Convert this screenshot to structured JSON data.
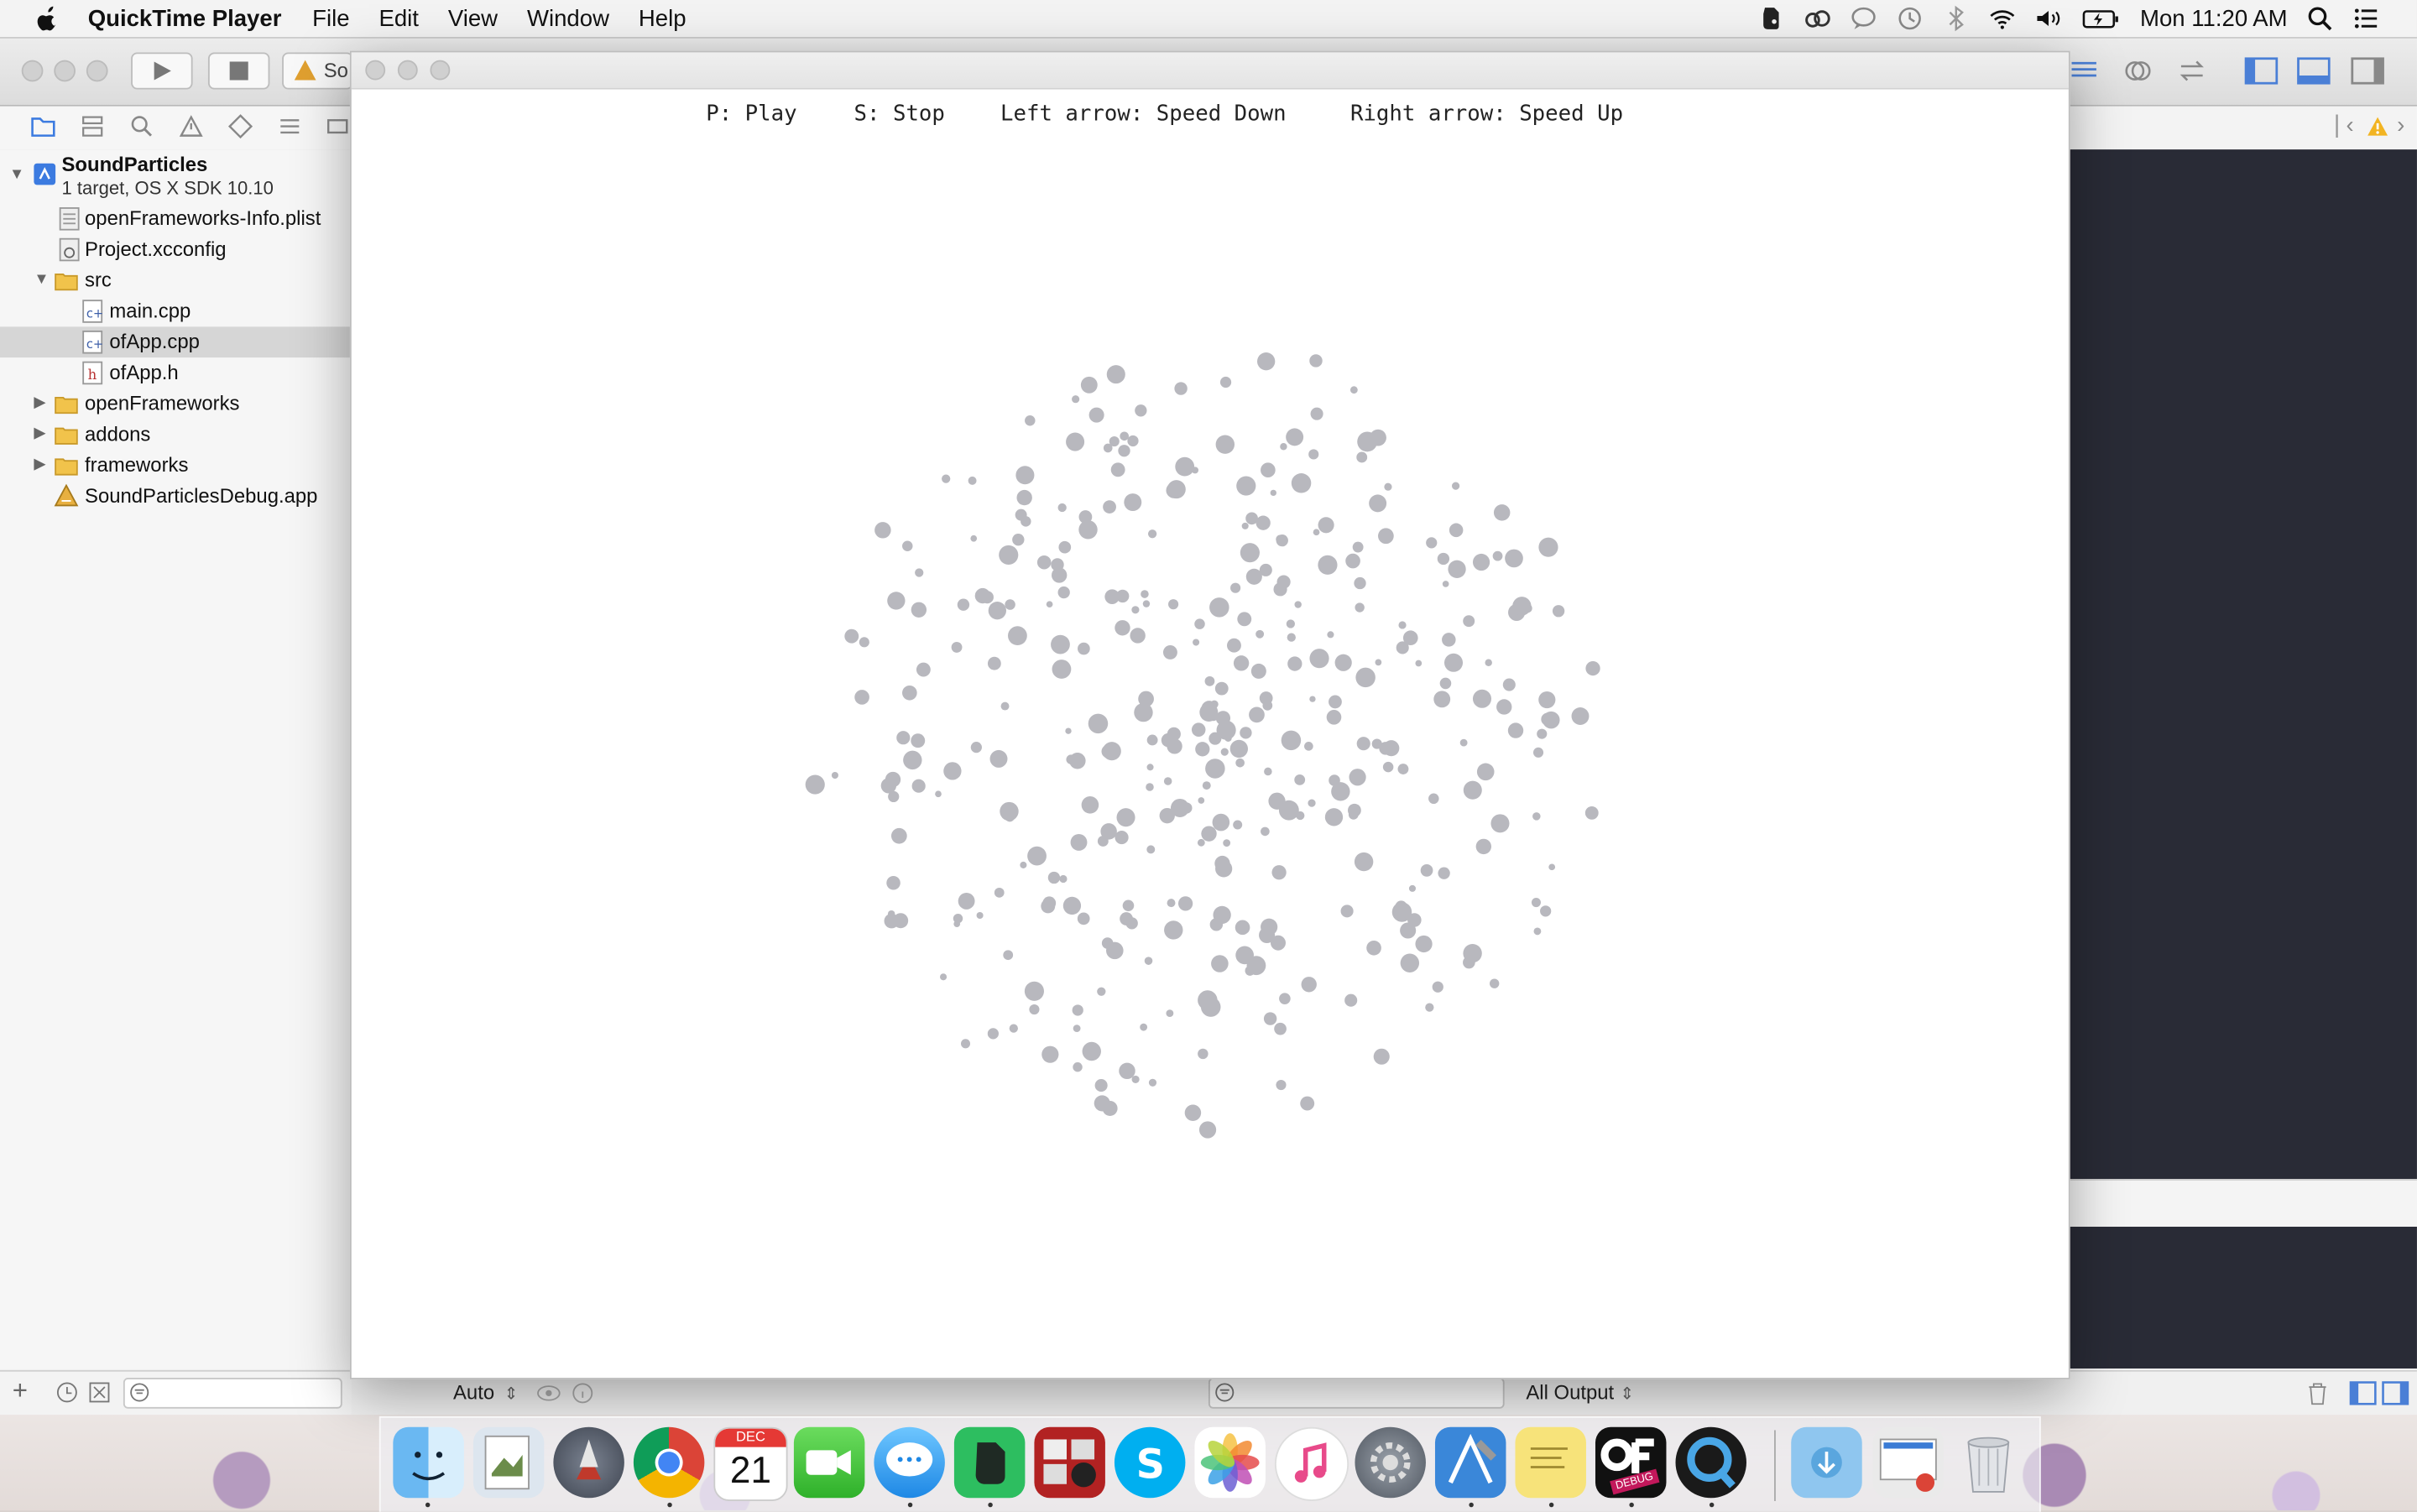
{
  "menubar": {
    "app_name": "QuickTime Player",
    "items": [
      "File",
      "Edit",
      "View",
      "Window",
      "Help"
    ],
    "clock": "Mon 11:20 AM",
    "status_icons": [
      "evernote-icon",
      "creative-cloud-icon",
      "messages-icon",
      "time-machine-icon",
      "bluetooth-icon",
      "wifi-icon",
      "volume-icon",
      "battery-icon",
      "spotlight-icon",
      "notification-center-icon"
    ]
  },
  "xcode": {
    "scheme_partial": "So",
    "project": {
      "name": "SoundParticles",
      "subtitle": "1 target, OS X SDK 10.10"
    },
    "files": [
      {
        "label": "openFrameworks-Info.plist",
        "icon": "plist-icon"
      },
      {
        "label": "Project.xcconfig",
        "icon": "xcconfig-icon"
      },
      {
        "label": "src",
        "icon": "folder-icon"
      },
      {
        "label": "main.cpp",
        "icon": "cpp-file-icon"
      },
      {
        "label": "ofApp.cpp",
        "icon": "cpp-file-icon"
      },
      {
        "label": "ofApp.h",
        "icon": "header-file-icon"
      },
      {
        "label": "openFrameworks",
        "icon": "folder-icon"
      },
      {
        "label": "addons",
        "icon": "folder-icon"
      },
      {
        "label": "frameworks",
        "icon": "folder-icon"
      },
      {
        "label": "SoundParticlesDebug.app",
        "icon": "app-icon"
      }
    ],
    "debug": {
      "auto_label": "Auto",
      "output_label": "All Output"
    }
  },
  "app": {
    "instructions": {
      "play": "P: Play",
      "stop": "S: Stop",
      "speed_down": "Left arrow: Speed Down",
      "speed_up": "Right arrow: Speed Up"
    },
    "particle_color": "#b8b8be"
  },
  "dock": {
    "apps": [
      "finder-icon",
      "preview-icon",
      "launchpad-icon",
      "chrome-icon",
      "calendar-icon",
      "facetime-icon",
      "messages-icon",
      "evernote-icon",
      "photo-booth-icon",
      "skype-icon",
      "photos-icon",
      "itunes-icon",
      "system-preferences-icon",
      "xcode-icon",
      "stickies-icon",
      "openframeworks-debug-icon",
      "quicktime-icon",
      "downloads-stack-icon",
      "documents-stack-icon",
      "trash-icon"
    ],
    "calendar_month": "DEC",
    "calendar_day": "21",
    "debug_badge": "DEBUG"
  }
}
